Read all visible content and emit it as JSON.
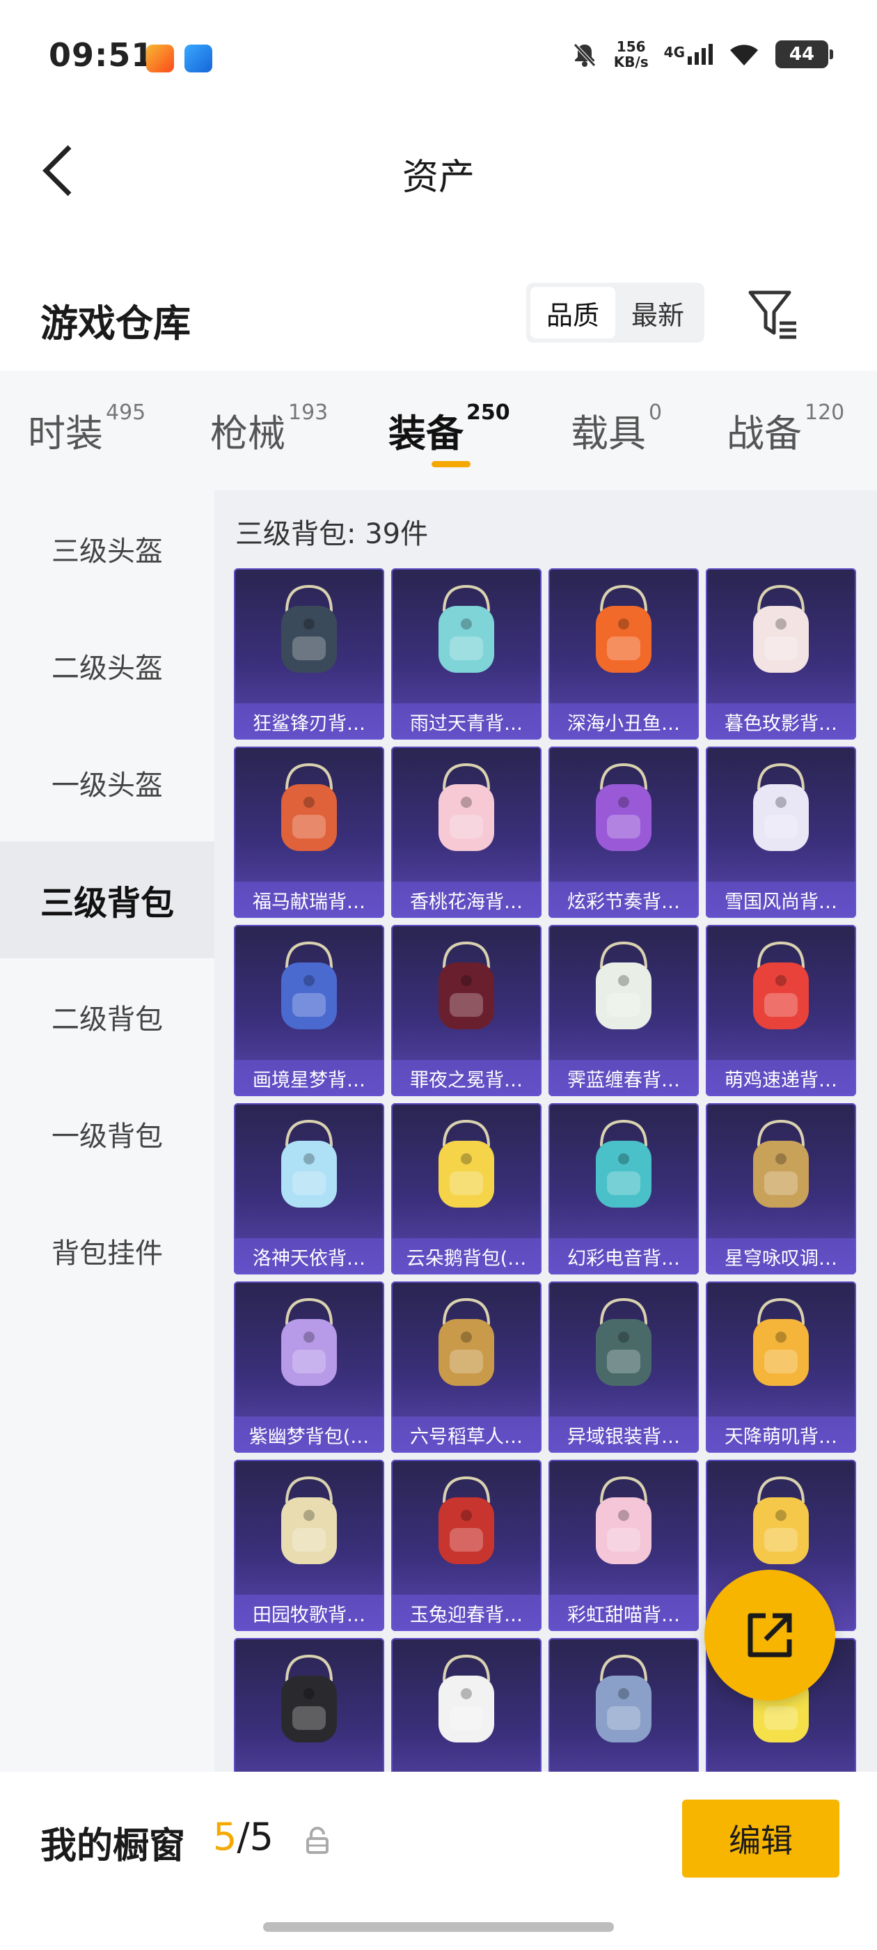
{
  "status": {
    "time": "09:51",
    "net_speed_value": "156",
    "net_speed_unit": "KB/s",
    "signal_label": "4G",
    "battery": "44"
  },
  "header": {
    "title": "资产"
  },
  "warehouse": {
    "title": "游戏仓库",
    "sort_options": [
      "品质",
      "最新"
    ],
    "active_sort": "品质"
  },
  "tabs": [
    {
      "label": "时装",
      "count": "495"
    },
    {
      "label": "枪械",
      "count": "193"
    },
    {
      "label": "装备",
      "count": "250",
      "active": true
    },
    {
      "label": "载具",
      "count": "0"
    },
    {
      "label": "战备",
      "count": "120"
    }
  ],
  "sidebar": {
    "items": [
      "三级头盔",
      "二级头盔",
      "一级头盔",
      "三级背包",
      "二级背包",
      "一级背包",
      "背包挂件"
    ],
    "active": "三级背包"
  },
  "content": {
    "count_label": "三级背包: 39件",
    "items": [
      {
        "name": "狂鲨锋刃背…",
        "color": "#3b4a5a"
      },
      {
        "name": "雨过天青背…",
        "color": "#7fd4d8"
      },
      {
        "name": "深海小丑鱼…",
        "color": "#f26a2a"
      },
      {
        "name": "暮色玫影背…",
        "color": "#f3e3e3"
      },
      {
        "name": "福马献瑞背…",
        "color": "#e0623a"
      },
      {
        "name": "香桃花海背…",
        "color": "#f6c9d4"
      },
      {
        "name": "炫彩节奏背…",
        "color": "#9a5ad8"
      },
      {
        "name": "雪国风尚背…",
        "color": "#e9e6f6"
      },
      {
        "name": "画境星梦背…",
        "color": "#4a6ad0"
      },
      {
        "name": "罪夜之冕背…",
        "color": "#6a1f2e"
      },
      {
        "name": "霁蓝缠春背…",
        "color": "#e9efe6"
      },
      {
        "name": "萌鸡速递背…",
        "color": "#e8423a"
      },
      {
        "name": "洛神天依背…",
        "color": "#aee0f6"
      },
      {
        "name": "云朵鹅背包(…",
        "color": "#f5d44a"
      },
      {
        "name": "幻彩电音背…",
        "color": "#4ac0c8"
      },
      {
        "name": "星穹咏叹调…",
        "color": "#c9a25a"
      },
      {
        "name": "紫幽梦背包(…",
        "color": "#b79ae8"
      },
      {
        "name": "六号稻草人…",
        "color": "#c89a4a"
      },
      {
        "name": "异域银装背…",
        "color": "#4a6a6a"
      },
      {
        "name": "天降萌叽背…",
        "color": "#f5b53a"
      },
      {
        "name": "田园牧歌背…",
        "color": "#e8dcb0"
      },
      {
        "name": "玉兔迎春背…",
        "color": "#c8342e"
      },
      {
        "name": "彩虹甜喵背…",
        "color": "#f4c6d8"
      },
      {
        "name": "",
        "color": "#f5c84a"
      },
      {
        "name": "",
        "color": "#2a2a2e"
      },
      {
        "name": "",
        "color": "#f2f2f2"
      },
      {
        "name": "",
        "color": "#8aa0c8"
      },
      {
        "name": "",
        "color": "#f5e04a"
      }
    ]
  },
  "showcase": {
    "label": "我的橱窗",
    "current": "5",
    "separator": "/",
    "total": "5",
    "edit_label": "编辑"
  },
  "icons": {
    "back": "chevron-left-icon",
    "filter": "filter-icon",
    "share": "share-icon",
    "lock": "lock-icon"
  },
  "colors": {
    "accent": "#f7b500",
    "card_bg": "#3a2f7a"
  }
}
